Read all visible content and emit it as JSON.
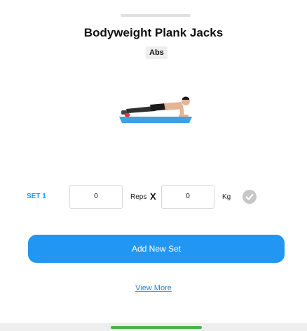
{
  "exercise": {
    "title": "Bodyweight Plank Jacks",
    "category": "Abs",
    "image_icon": "person-plank-illustration"
  },
  "sets": [
    {
      "label": "SET 1",
      "reps_value": "0",
      "reps_unit": "Reps",
      "times_symbol": "X",
      "weight_value": "0",
      "weight_unit": "Kg",
      "complete_icon": "check-circle-icon"
    }
  ],
  "actions": {
    "add_set_label": "Add New Set",
    "view_more_label": "View More"
  },
  "colors": {
    "accent": "#2196F3",
    "home_indicator": "#4CAF50",
    "check_inactive": "#c7c7c7",
    "mat": "#3fa0e6"
  }
}
